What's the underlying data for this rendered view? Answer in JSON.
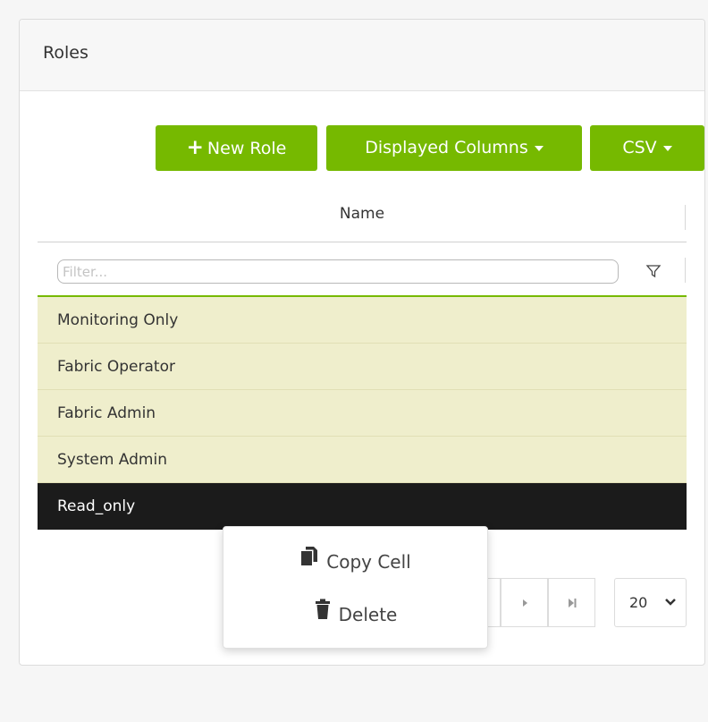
{
  "panel": {
    "title": "Roles"
  },
  "toolbar": {
    "new_role_label": "New Role",
    "displayed_columns_label": "Displayed Columns",
    "csv_label": "CSV"
  },
  "table": {
    "column_header": "Name",
    "filter_placeholder": "Filter...",
    "rows": [
      "Monitoring Only",
      "Fabric Operator",
      "Fabric Admin",
      "System Admin",
      "Read_only"
    ],
    "selected_row": "Read_only"
  },
  "pagination": {
    "page_size": "20"
  },
  "context_menu": {
    "items": [
      {
        "label": "Copy Cell",
        "icon": "copy-icon"
      },
      {
        "label": "Delete",
        "icon": "trash-icon"
      }
    ]
  },
  "colors": {
    "accent": "#76b900",
    "row_background": "#efeecc",
    "selected_row_background": "#1b1b1b"
  }
}
